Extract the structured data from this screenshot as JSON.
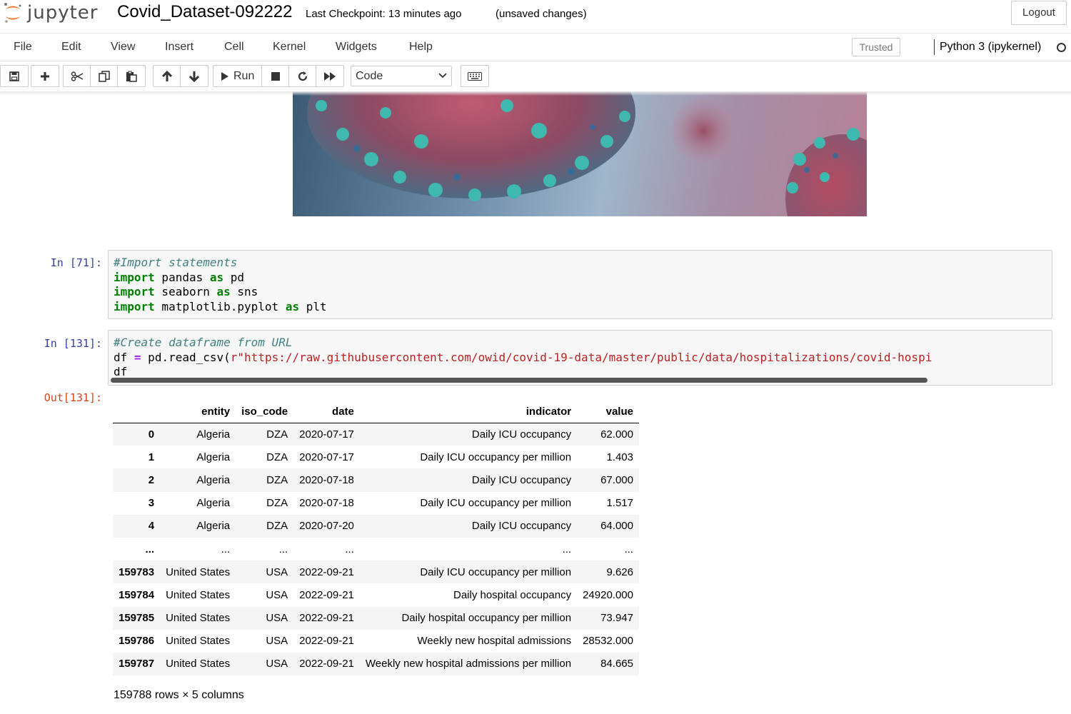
{
  "header": {
    "logo_text": "jupyter",
    "notebook_name": "Covid_Dataset-092222",
    "checkpoint": "Last Checkpoint: 13 minutes ago",
    "unsaved": "(unsaved changes)",
    "logout_label": "Logout"
  },
  "menubar": {
    "items": [
      "File",
      "Edit",
      "View",
      "Insert",
      "Cell",
      "Kernel",
      "Widgets",
      "Help"
    ],
    "trusted_label": "Trusted",
    "kernel_name": "Python 3 (ipykernel)"
  },
  "toolbar": {
    "run_label": "Run",
    "cell_type": "Code",
    "icons": [
      "save-icon",
      "plus-icon",
      "cut-icon",
      "copy-icon",
      "paste-icon",
      "arrow-up-icon",
      "arrow-down-icon",
      "run-icon",
      "stop-icon",
      "restart-icon",
      "fast-forward-icon",
      "keyboard-icon"
    ]
  },
  "cells": [
    {
      "prompt": "In [71]:",
      "lines": [
        [
          {
            "t": "#Import statements",
            "c": "comment"
          }
        ],
        [
          {
            "t": "import",
            "c": "kw"
          },
          {
            "t": " pandas ",
            "c": ""
          },
          {
            "t": "as",
            "c": "kw"
          },
          {
            "t": " pd",
            "c": ""
          }
        ],
        [
          {
            "t": "import",
            "c": "kw"
          },
          {
            "t": " seaborn ",
            "c": ""
          },
          {
            "t": "as",
            "c": "kw"
          },
          {
            "t": " sns",
            "c": ""
          }
        ],
        [
          {
            "t": "import",
            "c": "kw"
          },
          {
            "t": " matplotlib.pyplot ",
            "c": ""
          },
          {
            "t": "as",
            "c": "kw"
          },
          {
            "t": " plt",
            "c": ""
          }
        ]
      ]
    },
    {
      "prompt": "In [131]:",
      "out_prompt": "Out[131]:",
      "lines": [
        [
          {
            "t": "#Create dataframe from URL",
            "c": "comment"
          }
        ],
        [
          {
            "t": "df ",
            "c": ""
          },
          {
            "t": "=",
            "c": "op"
          },
          {
            "t": " pd.read_csv(",
            "c": ""
          },
          {
            "t": "r\"https://raw.githubusercontent.com/owid/covid-19-data/master/public/data/hospitalizations/covid-hospi",
            "c": "str"
          }
        ],
        [
          {
            "t": "df",
            "c": ""
          }
        ]
      ]
    }
  ],
  "output": {
    "columns": [
      "",
      "entity",
      "iso_code",
      "date",
      "indicator",
      "value"
    ],
    "rows": [
      [
        "0",
        "Algeria",
        "DZA",
        "2020-07-17",
        "Daily ICU occupancy",
        "62.000"
      ],
      [
        "1",
        "Algeria",
        "DZA",
        "2020-07-17",
        "Daily ICU occupancy per million",
        "1.403"
      ],
      [
        "2",
        "Algeria",
        "DZA",
        "2020-07-18",
        "Daily ICU occupancy",
        "67.000"
      ],
      [
        "3",
        "Algeria",
        "DZA",
        "2020-07-18",
        "Daily ICU occupancy per million",
        "1.517"
      ],
      [
        "4",
        "Algeria",
        "DZA",
        "2020-07-20",
        "Daily ICU occupancy",
        "64.000"
      ],
      [
        "...",
        "...",
        "...",
        "...",
        "...",
        "..."
      ],
      [
        "159783",
        "United States",
        "USA",
        "2022-09-21",
        "Daily ICU occupancy per million",
        "9.626"
      ],
      [
        "159784",
        "United States",
        "USA",
        "2022-09-21",
        "Daily hospital occupancy",
        "24920.000"
      ],
      [
        "159785",
        "United States",
        "USA",
        "2022-09-21",
        "Daily hospital occupancy per million",
        "73.947"
      ],
      [
        "159786",
        "United States",
        "USA",
        "2022-09-21",
        "Weekly new hospital admissions",
        "28532.000"
      ],
      [
        "159787",
        "United States",
        "USA",
        "2022-09-21",
        "Weekly new hospital admissions per million",
        "84.665"
      ]
    ],
    "footer": "159788 rows × 5 columns"
  }
}
